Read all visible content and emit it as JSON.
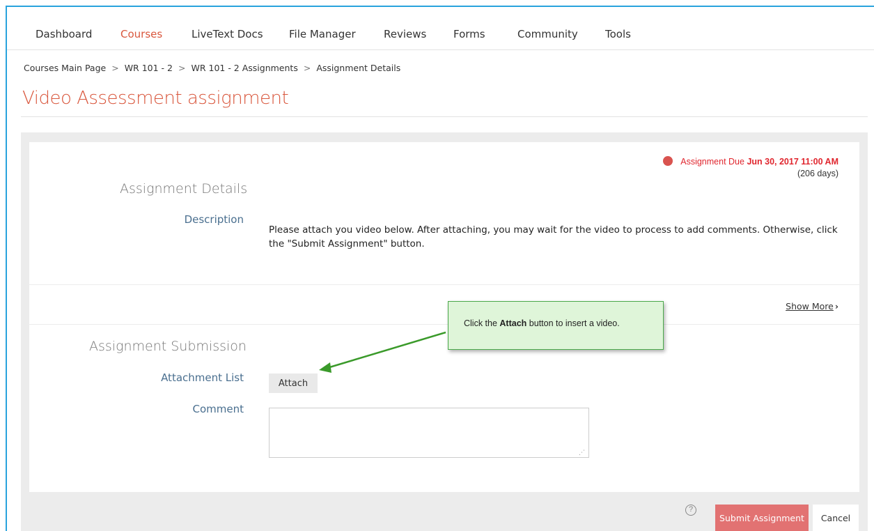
{
  "nav": {
    "items": [
      {
        "label": "Dashboard",
        "active": false
      },
      {
        "label": "Courses",
        "active": true
      },
      {
        "label": "LiveText Docs",
        "active": false
      },
      {
        "label": "File Manager",
        "active": false
      },
      {
        "label": "Reviews",
        "active": false
      },
      {
        "label": "Forms",
        "active": false
      },
      {
        "label": "Community",
        "active": false
      },
      {
        "label": "Tools",
        "active": false
      }
    ],
    "active_color": "#d9573d"
  },
  "breadcrumb": {
    "items": [
      "Courses Main Page",
      "WR 101 - 2",
      "WR 101 - 2 Assignments",
      "Assignment Details"
    ],
    "separator": ">"
  },
  "page": {
    "title": "Video Assessment assignment"
  },
  "due": {
    "label": "Assignment Due",
    "date": "Jun 30, 2017 11:00 AM",
    "days": "(206 days)",
    "color": "#e0262e"
  },
  "details": {
    "section_title": "Assignment Details",
    "description_label": "Description",
    "description_text": "Please attach you video below.  After attaching, you may wait for the video to process to add comments.  Otherwise, click the \"Submit Assignment\" button.",
    "show_more": "Show More"
  },
  "submission": {
    "section_title": "Assignment Submission",
    "attachment_label": "Attachment List",
    "attach_button": "Attach",
    "comment_label": "Comment",
    "comment_value": ""
  },
  "callout": {
    "prefix": "Click the ",
    "emphasis": "Attach",
    "suffix": " button to insert a video."
  },
  "footer": {
    "help_icon": "question-circle-icon",
    "submit_label": "Submit Assignment",
    "cancel_label": "Cancel",
    "submit_color": "#e27272"
  }
}
